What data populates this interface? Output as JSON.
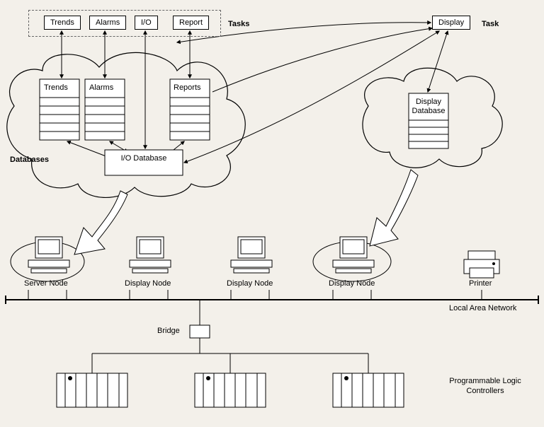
{
  "tasks": {
    "group_label": "Tasks",
    "trends": "Trends",
    "alarms": "Alarms",
    "io": "I/O",
    "report": "Report",
    "display": "Display",
    "display_task_label": "Task"
  },
  "databases": {
    "group_label": "Databases",
    "trends": "Trends",
    "alarms": "Alarms",
    "reports": "Reports",
    "io_db": "I/O Database",
    "display_db": "Display Database"
  },
  "nodes": {
    "server": "Server Node",
    "display1": "Display Node",
    "display2": "Display Node",
    "display3": "Display Node",
    "printer": "Printer"
  },
  "network": {
    "lan": "Local Area Network",
    "bridge": "Bridge",
    "plc": "Programmable Logic Controllers"
  }
}
